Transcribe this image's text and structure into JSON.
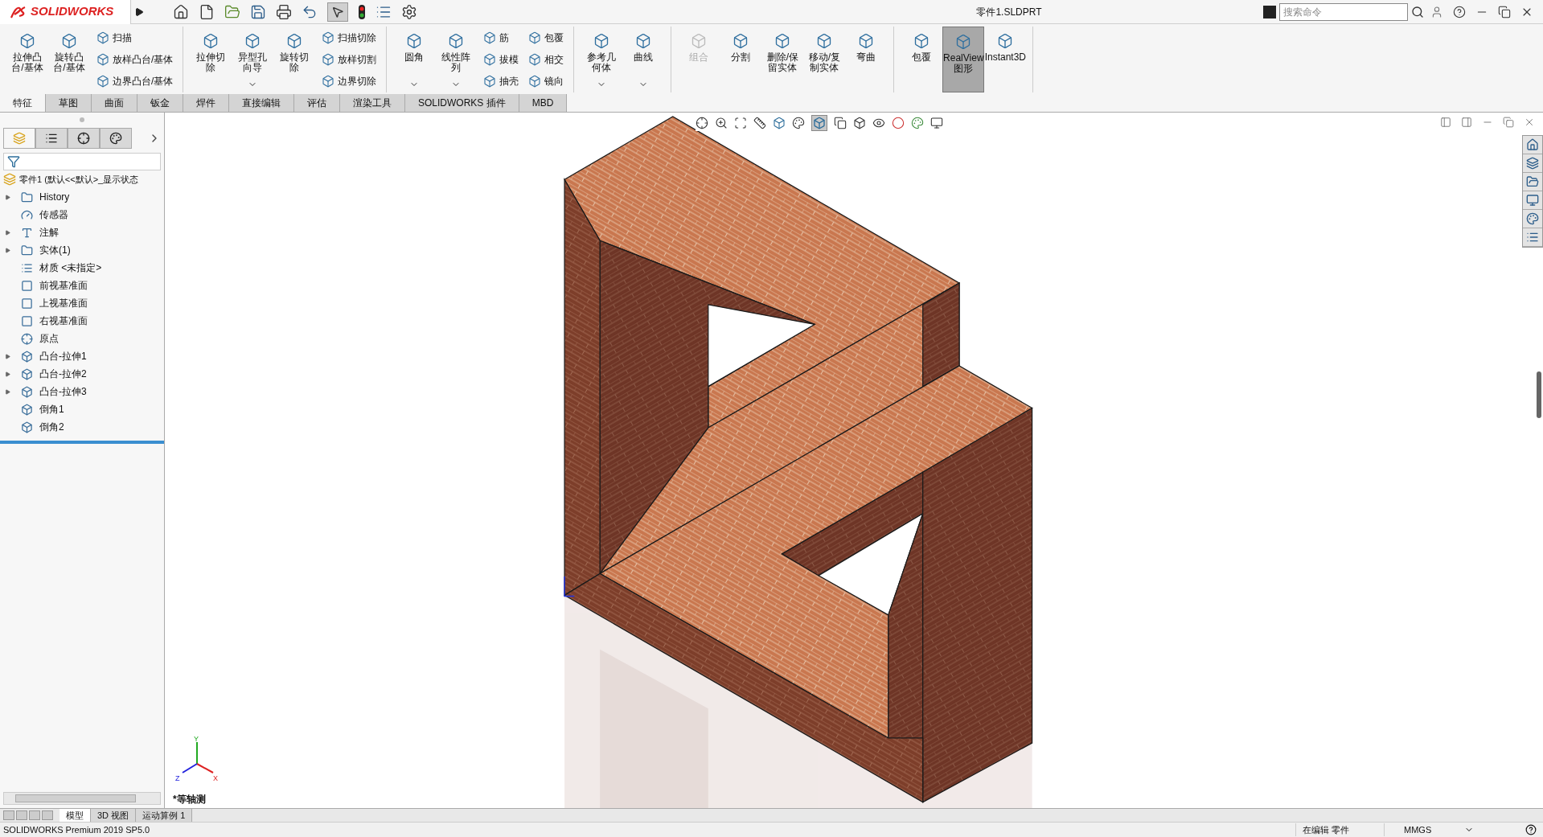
{
  "app": {
    "logo": "SOLIDWORKS"
  },
  "window": {
    "title": "零件1.SLDPRT"
  },
  "search": {
    "placeholder": "搜索命令"
  },
  "ribbon": {
    "groups": [
      {
        "items": [
          {
            "kind": "large",
            "label": "拉伸凸台/基体",
            "dropdown": false,
            "disabled": false,
            "selected": false
          },
          {
            "kind": "large",
            "label": "旋转凸台/基体",
            "dropdown": false,
            "disabled": false,
            "selected": false
          },
          {
            "kind": "small",
            "labels": [
              "扫描",
              "放样凸台/基体",
              "边界凸台/基体"
            ]
          }
        ]
      },
      {
        "items": [
          {
            "kind": "large",
            "label": "拉伸切除",
            "dropdown": false,
            "disabled": false,
            "selected": false
          },
          {
            "kind": "large",
            "label": "异型孔向导",
            "dropdown": true,
            "disabled": false,
            "selected": false
          },
          {
            "kind": "large",
            "label": "旋转切除",
            "dropdown": false,
            "disabled": false,
            "selected": false
          },
          {
            "kind": "small",
            "labels": [
              "扫描切除",
              "放样切割",
              "边界切除"
            ]
          }
        ]
      },
      {
        "items": [
          {
            "kind": "large",
            "label": "圆角",
            "dropdown": true,
            "disabled": false,
            "selected": false
          },
          {
            "kind": "large",
            "label": "线性阵列",
            "dropdown": true,
            "disabled": false,
            "selected": false
          },
          {
            "kind": "small",
            "labels": [
              "筋",
              "拔模",
              "抽壳"
            ]
          },
          {
            "kind": "small",
            "labels": [
              "包覆",
              "相交",
              "镜向"
            ]
          }
        ]
      },
      {
        "items": [
          {
            "kind": "large",
            "label": "参考几何体",
            "dropdown": true,
            "disabled": false,
            "selected": false
          },
          {
            "kind": "large",
            "label": "曲线",
            "dropdown": true,
            "disabled": false,
            "selected": false
          }
        ]
      },
      {
        "items": [
          {
            "kind": "large",
            "label": "组合",
            "dropdown": false,
            "disabled": true,
            "selected": false
          },
          {
            "kind": "large",
            "label": "分割",
            "dropdown": false,
            "disabled": false,
            "selected": false
          },
          {
            "kind": "large",
            "label": "删除/保留实体",
            "dropdown": false,
            "disabled": false,
            "selected": false
          },
          {
            "kind": "large",
            "label": "移动/复制实体",
            "dropdown": false,
            "disabled": false,
            "selected": false
          },
          {
            "kind": "large",
            "label": "弯曲",
            "dropdown": false,
            "disabled": false,
            "selected": false
          }
        ]
      },
      {
        "items": [
          {
            "kind": "large",
            "label": "包覆",
            "dropdown": false,
            "disabled": false,
            "selected": false
          },
          {
            "kind": "large",
            "label": "RealView 图形",
            "dropdown": false,
            "disabled": false,
            "selected": true
          },
          {
            "kind": "large",
            "label": "Instant3D",
            "dropdown": false,
            "disabled": false,
            "selected": false
          }
        ]
      }
    ]
  },
  "command_tabs": [
    {
      "label": "特征",
      "selected": true
    },
    {
      "label": "草图",
      "selected": false
    },
    {
      "label": "曲面",
      "selected": false
    },
    {
      "label": "钣金",
      "selected": false
    },
    {
      "label": "焊件",
      "selected": false
    },
    {
      "label": "直接编辑",
      "selected": false
    },
    {
      "label": "评估",
      "selected": false
    },
    {
      "label": "渲染工具",
      "selected": false
    },
    {
      "label": "SOLIDWORKS 插件",
      "selected": false
    },
    {
      "label": "MBD",
      "selected": false
    }
  ],
  "panel_tabs": [
    {
      "selected": true
    },
    {
      "selected": false
    },
    {
      "selected": false
    },
    {
      "selected": false
    }
  ],
  "feature_tree": {
    "root": "零件1  (默认<<默认>_显示状态",
    "items": [
      {
        "kind": "history",
        "label": "History",
        "expandable": true
      },
      {
        "kind": "sensor",
        "label": "传感器",
        "expandable": false
      },
      {
        "kind": "annotation",
        "label": "注解",
        "expandable": true
      },
      {
        "kind": "body",
        "label": "实体(1)",
        "expandable": true
      },
      {
        "kind": "material",
        "label": "材质 <未指定>",
        "expandable": false
      },
      {
        "kind": "plane",
        "label": "前视基准面",
        "expandable": false
      },
      {
        "kind": "plane",
        "label": "上视基准面",
        "expandable": false
      },
      {
        "kind": "plane",
        "label": "右视基准面",
        "expandable": false
      },
      {
        "kind": "origin",
        "label": "原点",
        "expandable": false
      },
      {
        "kind": "extrude",
        "label": "凸台-拉伸1",
        "expandable": true
      },
      {
        "kind": "extrude",
        "label": "凸台-拉伸2",
        "expandable": true
      },
      {
        "kind": "extrude",
        "label": "凸台-拉伸3",
        "expandable": true
      },
      {
        "kind": "chamfer",
        "label": "倒角1",
        "expandable": false
      },
      {
        "kind": "chamfer",
        "label": "倒角2",
        "expandable": false
      }
    ]
  },
  "viewport": {
    "view_label": "*等轴测",
    "triad": {
      "y": "Y",
      "x": "X",
      "z": "Z"
    }
  },
  "bottom_tabs": [
    {
      "label": "模型",
      "selected": true
    },
    {
      "label": "3D 视图",
      "selected": false
    },
    {
      "label": "运动算例 1",
      "selected": false
    }
  ],
  "status_bar": {
    "product": "SOLIDWORKS Premium 2019 SP5.0",
    "mode": "在编辑 零件",
    "units": "MMGS"
  }
}
